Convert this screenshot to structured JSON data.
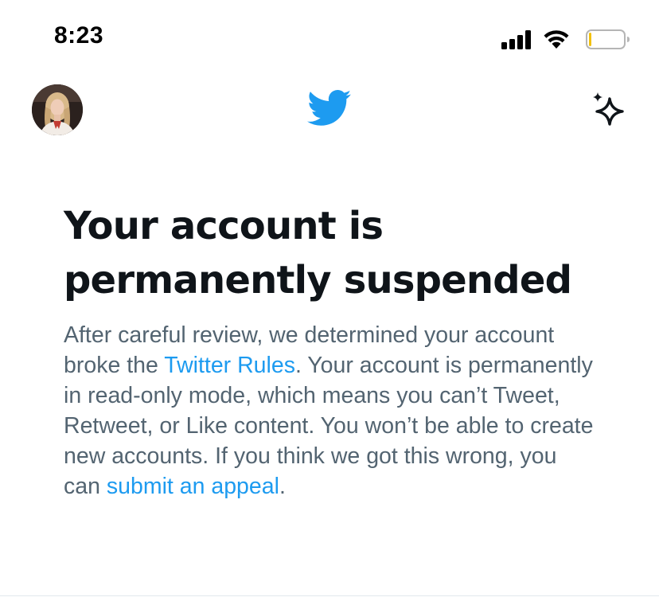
{
  "status_bar": {
    "time": "8:23",
    "signal_icon": "cellular-signal-icon",
    "wifi_icon": "wifi-icon",
    "battery_icon": "battery-low-icon",
    "battery_level": 0.08
  },
  "header": {
    "avatar_icon": "profile-avatar",
    "logo_icon": "twitter-bird-logo",
    "sparkle_icon": "sparkle-icon",
    "brand_color": "#1d9bf0"
  },
  "suspension": {
    "title_line1": "Your account is",
    "title_line2": "permanently suspended",
    "text_1": "After careful review, we determined your account broke the ",
    "rules_link": "Twitter Rules",
    "text_2": ". Your account is permanently in read-only mode, which means you can’t Tweet, Retweet, or Like content. You won’t be able to create new accounts. If you think we got this wrong, you can ",
    "appeal_link": "submit an appeal",
    "text_3": "."
  },
  "colors": {
    "title": "#0f1419",
    "body": "#536471",
    "link": "#1d9bf0",
    "divider": "#e1e8ed"
  }
}
